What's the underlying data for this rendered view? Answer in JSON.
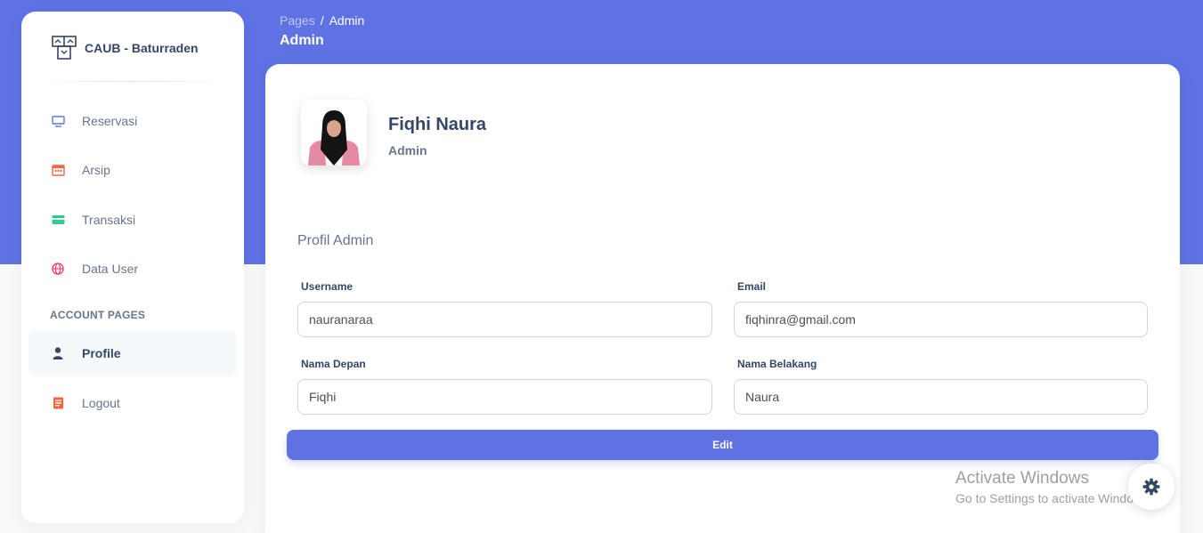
{
  "brand": {
    "name": "CAUB - Baturraden",
    "icon": "building-logo-icon"
  },
  "sidebar": {
    "items": [
      {
        "label": "Reservasi",
        "icon": "monitor-icon",
        "color": "#5e72e4"
      },
      {
        "label": "Arsip",
        "icon": "calendar-icon",
        "color": "#fb6340"
      },
      {
        "label": "Transaksi",
        "icon": "credit-card-icon",
        "color": "#2dce89"
      },
      {
        "label": "Data User",
        "icon": "globe-icon",
        "color": "#f5365c"
      }
    ],
    "section_heading": "ACCOUNT PAGES",
    "account_items": [
      {
        "label": "Profile",
        "icon": "user-icon",
        "color": "#344767",
        "active": true
      },
      {
        "label": "Logout",
        "icon": "document-icon",
        "color": "#fb6340"
      }
    ]
  },
  "header": {
    "breadcrumb": {
      "root": "Pages",
      "separator": "/",
      "current": "Admin"
    },
    "title": "Admin"
  },
  "profile": {
    "name": "Fiqhi Naura",
    "role": "Admin",
    "section_title": "Profil Admin",
    "fields": {
      "username": {
        "label": "Username",
        "value": "nauranaraa"
      },
      "email": {
        "label": "Email",
        "value": "fiqhinra@gmail.com"
      },
      "first_name": {
        "label": "Nama Depan",
        "value": "Fiqhi"
      },
      "last_name": {
        "label": "Nama Belakang",
        "value": "Naura"
      }
    },
    "edit_label": "Edit"
  },
  "watermark": {
    "title": "Activate Windows",
    "subtitle": "Go to Settings to activate Windows."
  },
  "colors": {
    "primary": "#5e72e4",
    "text_dark": "#344767",
    "text_muted": "#67748e"
  }
}
